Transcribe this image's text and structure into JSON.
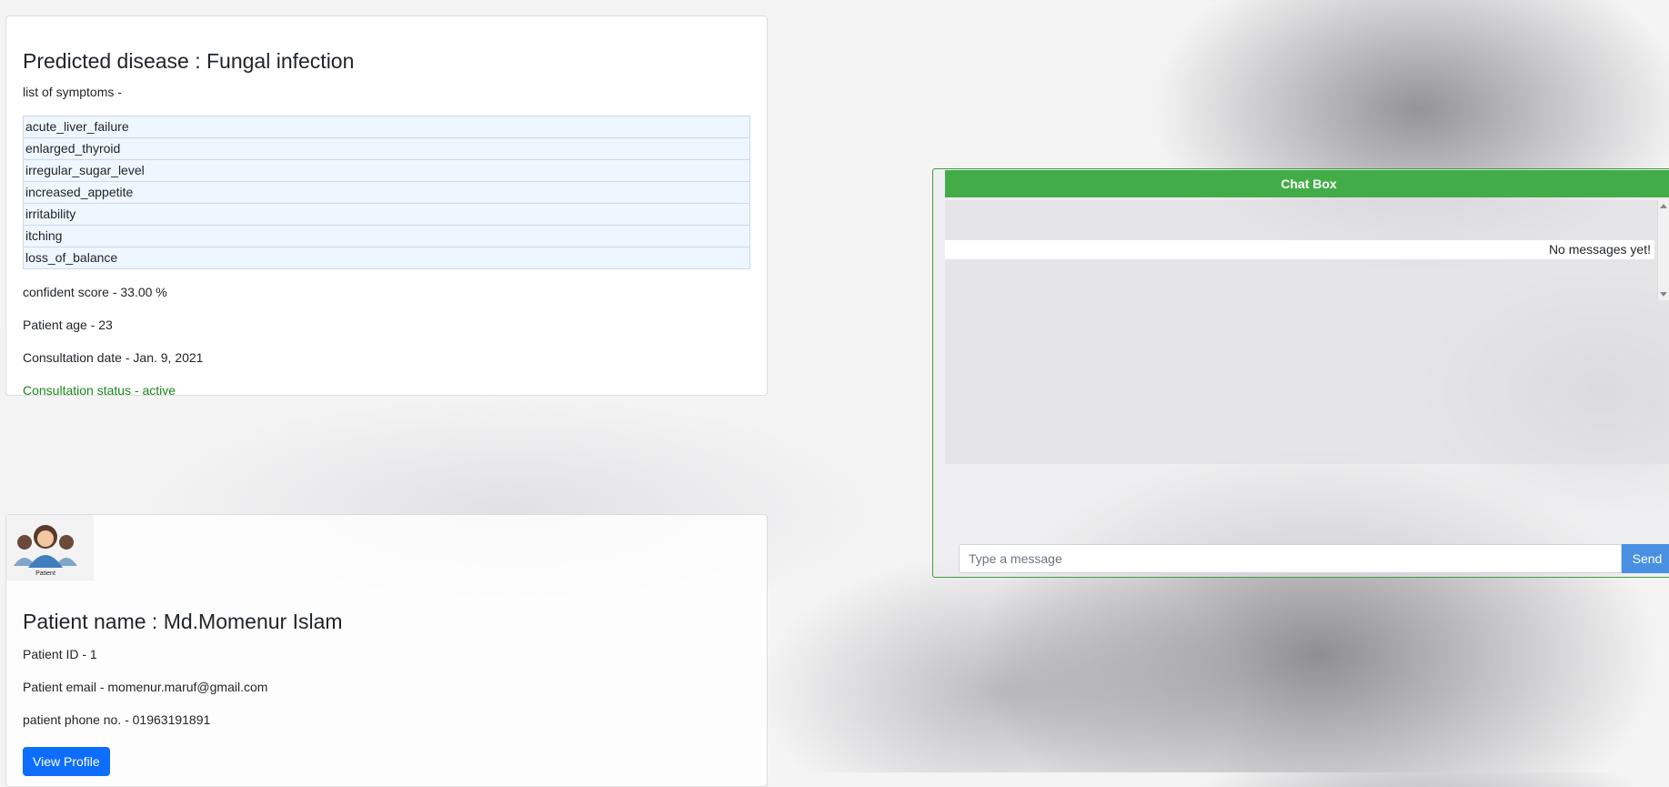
{
  "disease": {
    "title": "Predicted disease : Fungal infection",
    "symptoms_label": "list of symptoms -",
    "symptoms": [
      "acute_liver_failure",
      "enlarged_thyroid",
      "irregular_sugar_level",
      "increased_appetite",
      "irritability",
      "itching",
      "loss_of_balance"
    ],
    "confidence": "confident score - 33.00 %",
    "age": "Patient age - 23",
    "date": "Consultation date - Jan. 9, 2021",
    "status": "Consultation status - active"
  },
  "patient": {
    "avatar_caption": "Patient",
    "name": "Patient name : Md.Momenur Islam",
    "id": "Patient ID - 1",
    "email": "Patient email - momenur.maruf@gmail.com",
    "phone": "patient phone no. - 01963191891",
    "view_profile_label": "View Profile"
  },
  "chat": {
    "title": "Chat Box",
    "empty_text": "No messages yet!",
    "input_placeholder": "Type a message",
    "send_label": "Send"
  },
  "colors": {
    "chat_header": "#42ad48",
    "send_button": "#4a90e2",
    "view_profile_button": "#0d6efd",
    "status_active": "#198719"
  }
}
